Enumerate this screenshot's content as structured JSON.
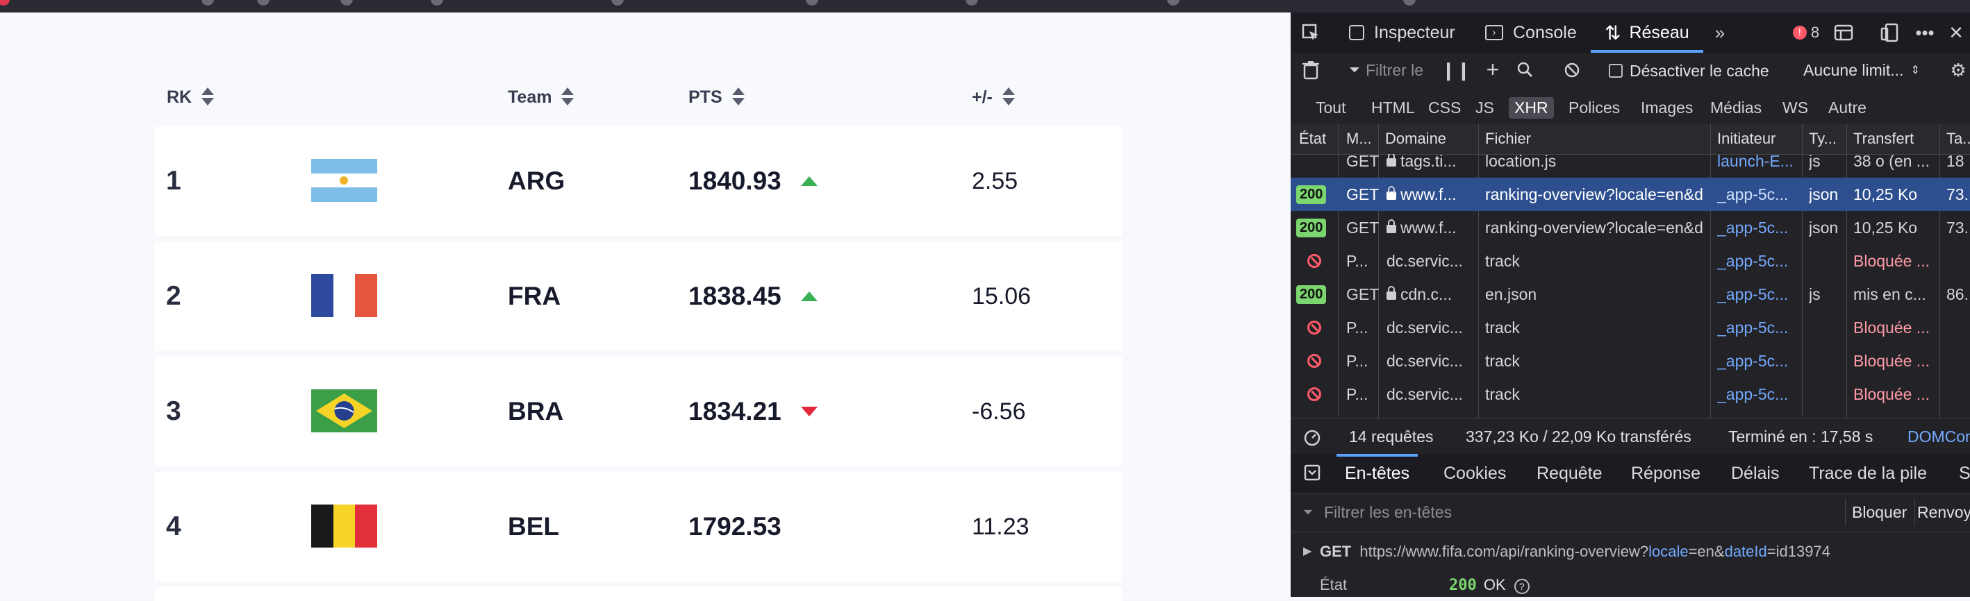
{
  "table": {
    "headers": {
      "rank": "RK",
      "team": "Team",
      "points": "PTS",
      "change": "+/-"
    },
    "rows": [
      {
        "rank": "1",
        "team": "ARG",
        "points": "1840.93",
        "trend": "up",
        "change": "2.55",
        "flag": "argentina-flag"
      },
      {
        "rank": "2",
        "team": "FRA",
        "points": "1838.45",
        "trend": "up",
        "change": "15.06",
        "flag": "france-flag"
      },
      {
        "rank": "3",
        "team": "BRA",
        "points": "1834.21",
        "trend": "down",
        "change": "-6.56",
        "flag": "brazil-flag"
      },
      {
        "rank": "4",
        "team": "BEL",
        "points": "1792.53",
        "trend": "none",
        "change": "11.23",
        "flag": "belgium-flag"
      }
    ]
  },
  "devtools": {
    "tabs": {
      "inspector": "Inspecteur",
      "console": "Console",
      "network": "Réseau"
    },
    "error_count": "8",
    "filter_placeholder": "Filtrer le",
    "disable_cache": "Désactiver le cache",
    "throttling": "Aucune limit...",
    "type_filters": [
      "Tout",
      "HTML",
      "CSS",
      "JS",
      "XHR",
      "Polices",
      "Images",
      "Médias",
      "WS",
      "Autre"
    ],
    "active_type_filter": "XHR",
    "columns": [
      "État",
      "M...",
      "Domaine",
      "Fichier",
      "Initiateur",
      "Ty...",
      "Transfert",
      "Ta..."
    ],
    "requests": [
      {
        "status": "",
        "method": "GET",
        "domain": "tags.ti...",
        "file": "location.js",
        "initiator": "launch-E...",
        "type": "js",
        "transfer": "38 o (en ...",
        "size": "18"
      },
      {
        "status": "200",
        "method": "GET",
        "domain": "www.f...",
        "file": "ranking-overview?locale=en&d",
        "initiator": "_app-5c...",
        "type": "json",
        "transfer": "10,25 Ko",
        "size": "73."
      },
      {
        "status": "200",
        "method": "GET",
        "domain": "www.f...",
        "file": "ranking-overview?locale=en&d",
        "initiator": "_app-5c...",
        "type": "json",
        "transfer": "10,25 Ko",
        "size": "73."
      },
      {
        "status": "blocked",
        "method": "P...",
        "domain": "dc.servic...",
        "file": "track",
        "initiator": "_app-5c...",
        "type": "",
        "transfer": "Bloquée ...",
        "size": ""
      },
      {
        "status": "200",
        "method": "GET",
        "domain": "cdn.c...",
        "file": "en.json",
        "initiator": "_app-5c...",
        "type": "js",
        "transfer": "mis en c...",
        "size": "86."
      },
      {
        "status": "blocked",
        "method": "P...",
        "domain": "dc.servic...",
        "file": "track",
        "initiator": "_app-5c...",
        "type": "",
        "transfer": "Bloquée ...",
        "size": ""
      },
      {
        "status": "blocked",
        "method": "P...",
        "domain": "dc.servic...",
        "file": "track",
        "initiator": "_app-5c...",
        "type": "",
        "transfer": "Bloquée ...",
        "size": ""
      },
      {
        "status": "blocked",
        "method": "P...",
        "domain": "dc.servic...",
        "file": "track",
        "initiator": "_app-5c...",
        "type": "",
        "transfer": "Bloquée ...",
        "size": ""
      }
    ],
    "summary": {
      "requests": "14 requêtes",
      "transferred": "337,23 Ko / 22,09 Ko transférés",
      "finished": "Terminé en : 17,58 s",
      "domcontent": "DOMCon"
    },
    "detail_tabs": [
      "En-têtes",
      "Cookies",
      "Requête",
      "Réponse",
      "Délais",
      "Trace de la pile",
      "S"
    ],
    "header_filter_placeholder": "Filtrer les en-têtes",
    "block_button": "Bloquer",
    "resend_button": "Renvoye",
    "request_line": {
      "method": "GET",
      "url_base": "https://www.fifa.com/api/ranking-overview?",
      "param1": "locale",
      "eq1": "=en&",
      "param2": "dateId",
      "eq2": "=id13974"
    },
    "state": {
      "label": "État",
      "code": "200",
      "text": "OK"
    }
  },
  "colors": {
    "trend_up": "#3cb055",
    "trend_down": "#e2283a",
    "selected_row": "#2d4f8f",
    "status_ok": "#7bd66f",
    "blocked": "#ff5a6a"
  }
}
